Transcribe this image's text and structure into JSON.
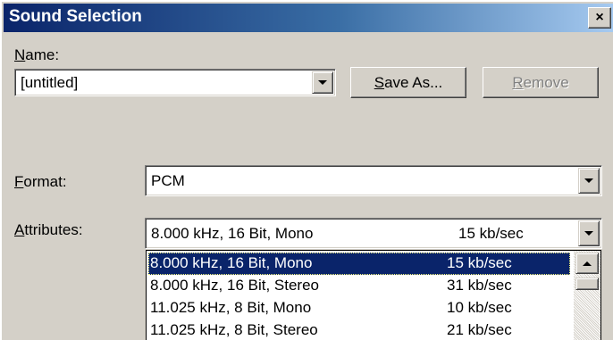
{
  "window": {
    "title": "Sound Selection",
    "close_label": "×"
  },
  "name": {
    "label_mnemonic": "N",
    "label_rest": "ame:",
    "value": "[untitled]",
    "save_as_mnemonic": "S",
    "save_as_rest": "ave As...",
    "remove_mnemonic": "R",
    "remove_rest": "emove"
  },
  "format": {
    "label_mnemonic": "F",
    "label_rest": "ormat:",
    "value": "PCM"
  },
  "attributes": {
    "label_mnemonic": "A",
    "label_rest": "ttributes:",
    "value": "8.000 kHz, 16 Bit, Mono",
    "rate": "15 kb/sec",
    "options": [
      {
        "format": "8.000 kHz, 16 Bit, Mono",
        "rate": "15 kb/sec",
        "selected": true
      },
      {
        "format": "8.000 kHz, 16 Bit, Stereo",
        "rate": "31 kb/sec",
        "selected": false
      },
      {
        "format": "11.025 kHz, 8 Bit, Mono",
        "rate": "10 kb/sec",
        "selected": false
      },
      {
        "format": "11.025 kHz, 8 Bit, Stereo",
        "rate": "21 kb/sec",
        "selected": false
      }
    ]
  },
  "colors": {
    "face": "#d4d0c8",
    "titlebar_start": "#0a246a",
    "titlebar_end": "#a6caf0",
    "selection": "#0a246a"
  },
  "icons": [
    "close-icon",
    "chevron-down-icon",
    "chevron-up-icon"
  ]
}
